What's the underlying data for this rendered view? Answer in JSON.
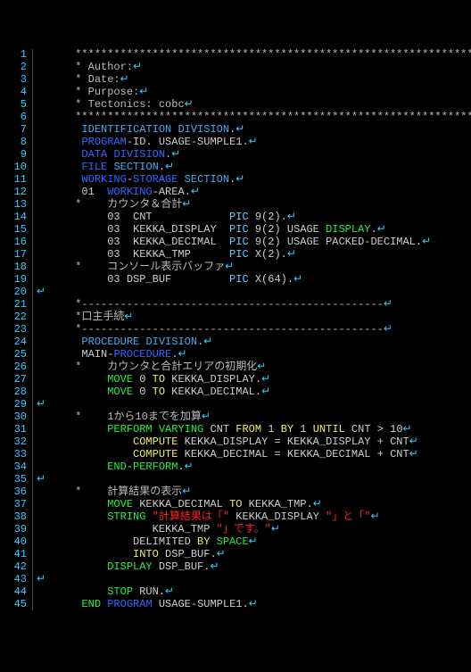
{
  "eol": "↵",
  "line_numbers": [
    "1",
    "2",
    "3",
    "4",
    "5",
    "6",
    "7",
    "8",
    "9",
    "10",
    "11",
    "12",
    "13",
    "14",
    "15",
    "16",
    "17",
    "18",
    "19",
    "20",
    "21",
    "22",
    "23",
    "24",
    "25",
    "26",
    "27",
    "28",
    "29",
    "30",
    "31",
    "32",
    "33",
    "34",
    "35",
    "36",
    "37",
    "38",
    "39",
    "40",
    "41",
    "42",
    "43",
    "44",
    "45"
  ],
  "lines": [
    {
      "indent": "      ",
      "tokens": [
        {
          "c": "cmt",
          "t": "******************************************************************"
        }
      ]
    },
    {
      "indent": "      ",
      "tokens": [
        {
          "c": "cmt",
          "t": "* Author:"
        }
      ]
    },
    {
      "indent": "      ",
      "tokens": [
        {
          "c": "cmt",
          "t": "* Date:"
        }
      ]
    },
    {
      "indent": "      ",
      "tokens": [
        {
          "c": "cmt",
          "t": "* Purpose:"
        }
      ]
    },
    {
      "indent": "      ",
      "tokens": [
        {
          "c": "cmt",
          "t": "* Tectonics: cobc"
        }
      ]
    },
    {
      "indent": "      ",
      "tokens": [
        {
          "c": "cmt",
          "t": "******************************************************************"
        }
      ]
    },
    {
      "indent": "       ",
      "tokens": [
        {
          "c": "kw2",
          "t": "IDENTIFICATION"
        },
        {
          "c": "txt",
          "t": " "
        },
        {
          "c": "kw2",
          "t": "DIVISION"
        },
        {
          "c": "txt",
          "t": "."
        }
      ]
    },
    {
      "indent": "       ",
      "tokens": [
        {
          "c": "kw1",
          "t": "PROGRAM"
        },
        {
          "c": "txt",
          "t": "-ID. USAGE-SUMPLE1."
        }
      ]
    },
    {
      "indent": "       ",
      "tokens": [
        {
          "c": "kw1",
          "t": "DATA"
        },
        {
          "c": "txt",
          "t": " "
        },
        {
          "c": "kw1",
          "t": "DIVISION"
        },
        {
          "c": "txt",
          "t": "."
        }
      ]
    },
    {
      "indent": "       ",
      "tokens": [
        {
          "c": "kw1",
          "t": "FILE"
        },
        {
          "c": "txt",
          "t": " "
        },
        {
          "c": "kw2",
          "t": "SECTION"
        },
        {
          "c": "txt",
          "t": "."
        }
      ]
    },
    {
      "indent": "       ",
      "tokens": [
        {
          "c": "kw1",
          "t": "WORKING"
        },
        {
          "c": "txt",
          "t": "-"
        },
        {
          "c": "kw1",
          "t": "STORAGE"
        },
        {
          "c": "txt",
          "t": " "
        },
        {
          "c": "kw2",
          "t": "SECTION"
        },
        {
          "c": "txt",
          "t": "."
        }
      ]
    },
    {
      "indent": "       ",
      "tokens": [
        {
          "c": "txt",
          "t": "01  "
        },
        {
          "c": "kw1",
          "t": "WORKING"
        },
        {
          "c": "txt",
          "t": "-AREA."
        }
      ]
    },
    {
      "indent": "      ",
      "tokens": [
        {
          "c": "cmt",
          "t": "*    カウンタ＆合計"
        }
      ]
    },
    {
      "indent": "           ",
      "tokens": [
        {
          "c": "txt",
          "t": "03  CNT            "
        },
        {
          "c": "kw3",
          "t": "PIC"
        },
        {
          "c": "txt",
          "t": " 9(2)."
        }
      ]
    },
    {
      "indent": "           ",
      "tokens": [
        {
          "c": "txt",
          "t": "03  KEKKA_DISPLAY  "
        },
        {
          "c": "kw3",
          "t": "PIC"
        },
        {
          "c": "txt",
          "t": " 9(2) USAGE "
        },
        {
          "c": "grn",
          "t": "DISPLAY"
        },
        {
          "c": "txt",
          "t": "."
        }
      ]
    },
    {
      "indent": "           ",
      "tokens": [
        {
          "c": "txt",
          "t": "03  KEKKA_DECIMAL  "
        },
        {
          "c": "kw3",
          "t": "PIC"
        },
        {
          "c": "txt",
          "t": " 9(2) USAGE PACKED-DECIMAL."
        }
      ]
    },
    {
      "indent": "           ",
      "tokens": [
        {
          "c": "txt",
          "t": "03  KEKKA_TMP      "
        },
        {
          "c": "kw3",
          "t": "PIC"
        },
        {
          "c": "txt",
          "t": " X(2)."
        }
      ]
    },
    {
      "indent": "      ",
      "tokens": [
        {
          "c": "cmt",
          "t": "*    コンソール表示バッファ"
        }
      ]
    },
    {
      "indent": "           ",
      "tokens": [
        {
          "c": "txt",
          "t": "03 DSP_BUF         "
        },
        {
          "c": "kw3",
          "t": "PIC"
        },
        {
          "c": "txt",
          "t": " X(64)."
        }
      ]
    },
    {
      "indent": "",
      "tokens": []
    },
    {
      "indent": "      ",
      "tokens": [
        {
          "c": "cmt",
          "t": "*-----------------------------------------------"
        }
      ]
    },
    {
      "indent": "      ",
      "tokens": [
        {
          "c": "cmt",
          "t": "*口主手続"
        }
      ]
    },
    {
      "indent": "      ",
      "tokens": [
        {
          "c": "cmt",
          "t": "*-----------------------------------------------"
        }
      ]
    },
    {
      "indent": "       ",
      "tokens": [
        {
          "c": "kw2",
          "t": "PROCEDURE"
        },
        {
          "c": "txt",
          "t": " "
        },
        {
          "c": "kw2",
          "t": "DIVISION"
        },
        {
          "c": "txt",
          "t": "."
        }
      ]
    },
    {
      "indent": "       ",
      "tokens": [
        {
          "c": "txt",
          "t": "MAIN-"
        },
        {
          "c": "kw1",
          "t": "PROCEDURE"
        },
        {
          "c": "txt",
          "t": "."
        }
      ]
    },
    {
      "indent": "      ",
      "tokens": [
        {
          "c": "cmt",
          "t": "*    カウンタと合計エリアの初期化"
        }
      ]
    },
    {
      "indent": "           ",
      "tokens": [
        {
          "c": "grn",
          "t": "MOVE"
        },
        {
          "c": "txt",
          "t": " 0 "
        },
        {
          "c": "ylw",
          "t": "TO"
        },
        {
          "c": "txt",
          "t": " KEKKA_DISPLAY."
        }
      ]
    },
    {
      "indent": "           ",
      "tokens": [
        {
          "c": "grn",
          "t": "MOVE"
        },
        {
          "c": "txt",
          "t": " 0 "
        },
        {
          "c": "ylw",
          "t": "TO"
        },
        {
          "c": "txt",
          "t": " KEKKA_DECIMAL."
        }
      ]
    },
    {
      "indent": "",
      "tokens": []
    },
    {
      "indent": "      ",
      "tokens": [
        {
          "c": "cmt",
          "t": "*    1から10までを加算"
        }
      ]
    },
    {
      "indent": "           ",
      "tokens": [
        {
          "c": "grn",
          "t": "PERFORM"
        },
        {
          "c": "txt",
          "t": " "
        },
        {
          "c": "grn",
          "t": "VARYING"
        },
        {
          "c": "txt",
          "t": " CNT "
        },
        {
          "c": "ylw",
          "t": "FROM"
        },
        {
          "c": "txt",
          "t": " 1 "
        },
        {
          "c": "ylw",
          "t": "BY"
        },
        {
          "c": "txt",
          "t": " 1 "
        },
        {
          "c": "ylw",
          "t": "UNTIL"
        },
        {
          "c": "txt",
          "t": " CNT > 10"
        }
      ]
    },
    {
      "indent": "               ",
      "tokens": [
        {
          "c": "ylw",
          "t": "COMPUTE"
        },
        {
          "c": "txt",
          "t": " KEKKA_DISPLAY = KEKKA_DISPLAY + CNT"
        }
      ]
    },
    {
      "indent": "               ",
      "tokens": [
        {
          "c": "ylw",
          "t": "COMPUTE"
        },
        {
          "c": "txt",
          "t": " KEKKA_DECIMAL = KEKKA_DECIMAL + CNT"
        }
      ]
    },
    {
      "indent": "           ",
      "tokens": [
        {
          "c": "grn",
          "t": "END"
        },
        {
          "c": "txt",
          "t": "-"
        },
        {
          "c": "grn",
          "t": "PERFORM"
        },
        {
          "c": "txt",
          "t": "."
        }
      ]
    },
    {
      "indent": "",
      "tokens": []
    },
    {
      "indent": "      ",
      "tokens": [
        {
          "c": "cmt",
          "t": "*    計算結果の表示"
        }
      ]
    },
    {
      "indent": "           ",
      "tokens": [
        {
          "c": "grn",
          "t": "MOVE"
        },
        {
          "c": "txt",
          "t": " KEKKA_DECIMAL "
        },
        {
          "c": "ylw",
          "t": "TO"
        },
        {
          "c": "txt",
          "t": " KEKKA_TMP."
        }
      ]
    },
    {
      "indent": "           ",
      "tokens": [
        {
          "c": "grn",
          "t": "STRING"
        },
        {
          "c": "txt",
          "t": " "
        },
        {
          "c": "red",
          "t": "\"計算結果は「\""
        },
        {
          "c": "txt",
          "t": " KEKKA_DISPLAY "
        },
        {
          "c": "red",
          "t": "\"」と「\""
        }
      ]
    },
    {
      "indent": "                  ",
      "tokens": [
        {
          "c": "txt",
          "t": "KEKKA_TMP "
        },
        {
          "c": "red",
          "t": "\"」です。\""
        }
      ]
    },
    {
      "indent": "               ",
      "tokens": [
        {
          "c": "txt",
          "t": "DELIMITED "
        },
        {
          "c": "ylw",
          "t": "BY"
        },
        {
          "c": "txt",
          "t": " "
        },
        {
          "c": "grn",
          "t": "SPACE"
        }
      ]
    },
    {
      "indent": "               ",
      "tokens": [
        {
          "c": "ylw",
          "t": "INTO"
        },
        {
          "c": "txt",
          "t": " DSP_BUF."
        }
      ]
    },
    {
      "indent": "           ",
      "tokens": [
        {
          "c": "grn",
          "t": "DISPLAY"
        },
        {
          "c": "txt",
          "t": " DSP_BUF."
        }
      ]
    },
    {
      "indent": "",
      "tokens": []
    },
    {
      "indent": "           ",
      "tokens": [
        {
          "c": "grn",
          "t": "STOP"
        },
        {
          "c": "txt",
          "t": " RUN."
        }
      ]
    },
    {
      "indent": "       ",
      "tokens": [
        {
          "c": "grn",
          "t": "END"
        },
        {
          "c": "txt",
          "t": " "
        },
        {
          "c": "kw1",
          "t": "PROGRAM"
        },
        {
          "c": "txt",
          "t": " USAGE-SUMPLE1."
        }
      ]
    }
  ]
}
